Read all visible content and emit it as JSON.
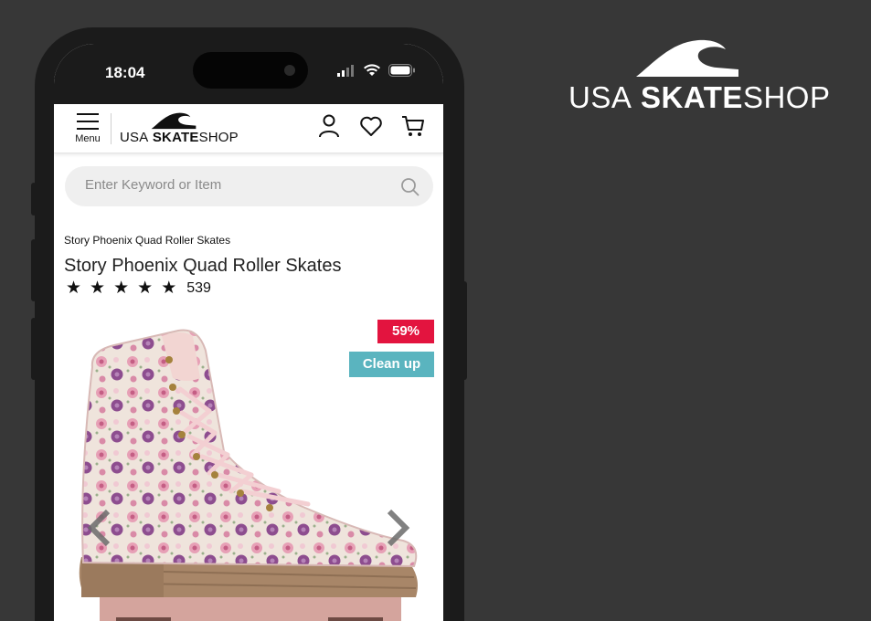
{
  "brand": {
    "usa": "USA",
    "skate": "SKATE",
    "shop": "SHOP"
  },
  "status_bar": {
    "time": "18:04",
    "icons": [
      "signal-icon",
      "wifi-icon",
      "battery-icon"
    ]
  },
  "header": {
    "menu_label": "Menu",
    "logo": {
      "usa": "USA",
      "skate": "SKATE",
      "shop": "SHOP"
    },
    "icons": [
      "account-icon",
      "heart-icon",
      "cart-icon"
    ]
  },
  "search": {
    "placeholder": "Enter Keyword or Item",
    "value": ""
  },
  "product": {
    "breadcrumb": "Story Phoenix Quad Roller Skates",
    "title": "Story Phoenix Quad Roller Skates",
    "rating": {
      "stars": 5,
      "max": 5,
      "count": "539"
    },
    "badges": {
      "discount": "59%",
      "tag": "Clean up"
    }
  },
  "colors": {
    "discount_badge": "#e3143f",
    "tag_badge": "#5ab4bf",
    "background": "#373737"
  }
}
